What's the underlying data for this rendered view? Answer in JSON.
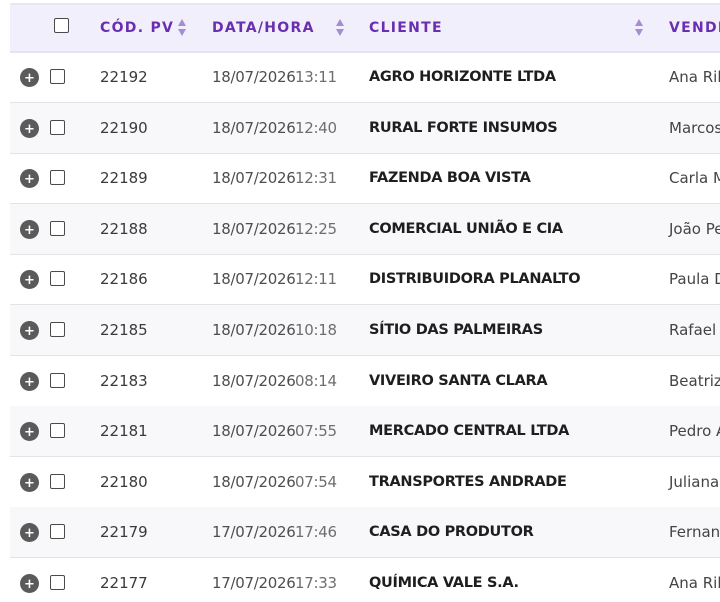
{
  "table": {
    "columns": {
      "code": "CÓD. PV",
      "datetime": "DATA/HORA",
      "client": "CLIENTE",
      "seller": "VENDE"
    },
    "expand_symbol": "+",
    "rows": [
      {
        "code": "22192",
        "date": "18/07/2026",
        "time": "13:11",
        "client": "AGRO HORIZONTE LTDA",
        "seller": "Ana Rib"
      },
      {
        "code": "22190",
        "date": "18/07/2026",
        "time": "12:40",
        "client": "RURAL FORTE INSUMOS",
        "seller": "Marcos"
      },
      {
        "code": "22189",
        "date": "18/07/2026",
        "time": "12:31",
        "client": "FAZENDA BOA VISTA",
        "seller": "Carla M"
      },
      {
        "code": "22188",
        "date": "18/07/2026",
        "time": "12:25",
        "client": "COMERCIAL UNIÃO E CIA",
        "seller": "João Pe"
      },
      {
        "code": "22186",
        "date": "18/07/2026",
        "time": "12:11",
        "client": "DISTRIBUIDORA PLANALTO",
        "seller": "Paula D"
      },
      {
        "code": "22185",
        "date": "18/07/2026",
        "time": "10:18",
        "client": "SÍTIO DAS PALMEIRAS",
        "seller": "Rafael C"
      },
      {
        "code": "22183",
        "date": "18/07/2026",
        "time": "08:14",
        "client": "VIVEIRO SANTA CLARA",
        "seller": "Beatriz"
      },
      {
        "code": "22181",
        "date": "18/07/2026",
        "time": "07:55",
        "client": "MERCADO CENTRAL LTDA",
        "seller": "Pedro A"
      },
      {
        "code": "22180",
        "date": "18/07/2026",
        "time": "07:54",
        "client": "TRANSPORTES ANDRADE",
        "seller": "Juliana"
      },
      {
        "code": "22179",
        "date": "17/07/2026",
        "time": "17:46",
        "client": "CASA DO PRODUTOR",
        "seller": "Fernanc"
      },
      {
        "code": "22177",
        "date": "17/07/2026",
        "time": "17:33",
        "client": "QUÍMICA VALE S.A.",
        "seller": "Ana Rib"
      }
    ]
  },
  "colors": {
    "header_bg": "#f1effb",
    "header_text": "#6a2fb0",
    "sort_icon": "#a78bd6",
    "expand_icon_bg": "#5a5a5a",
    "row_alt_bg": "#f8f8fa"
  }
}
